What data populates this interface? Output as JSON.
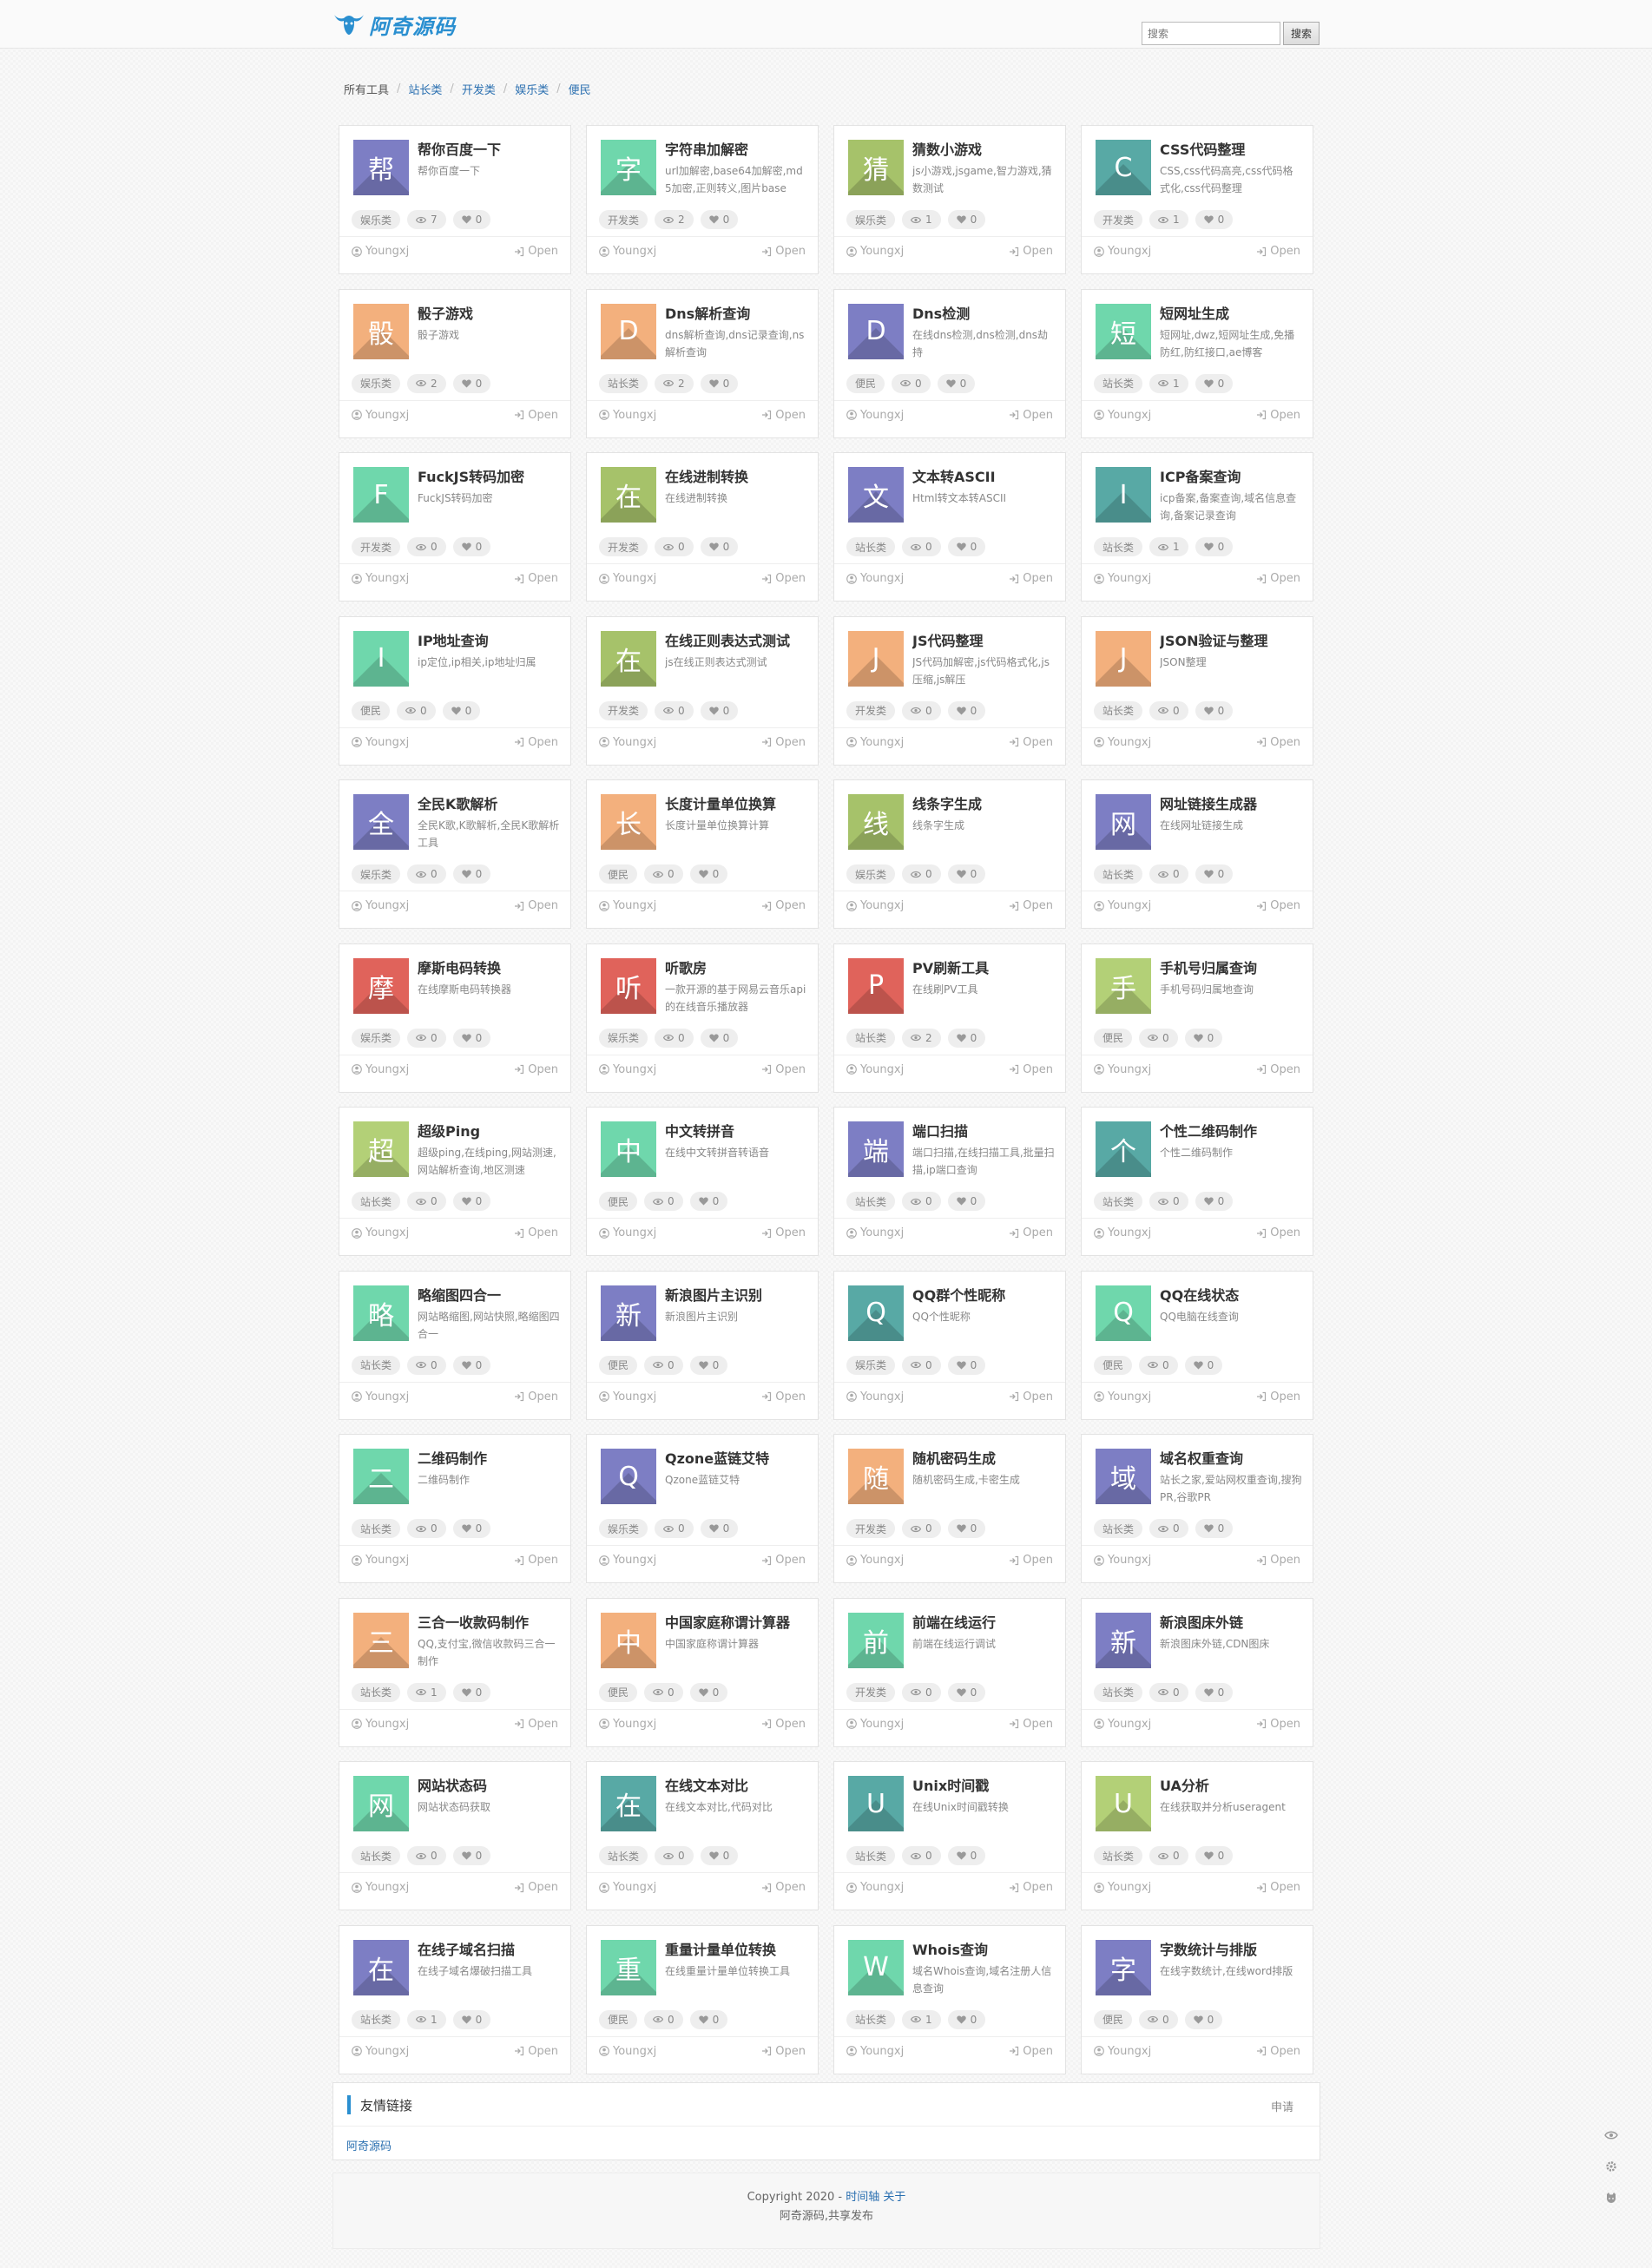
{
  "site": {
    "logo_text": "阿奇源码"
  },
  "search": {
    "placeholder": "搜索",
    "button_label": "搜索"
  },
  "breadcrumb": [
    "所有工具",
    "站长类",
    "开发类",
    "娱乐类",
    "便民"
  ],
  "card_common": {
    "author": "Youngxj",
    "open_label": "Open"
  },
  "colors": {
    "purple": "#7d7ec4",
    "mint": "#6fd7ac",
    "olive": "#a6c26a",
    "teal": "#58a9a5",
    "peach": "#f3b07d",
    "red": "#e0635b",
    "lime": "#b3d077",
    "accent_blue": "#2a8fd0"
  },
  "tools": [
    {
      "icon_char": "帮",
      "color": "purple",
      "title": "帮你百度一下",
      "desc": "帮你百度一下",
      "category": "娱乐类",
      "views": "7",
      "likes": "0"
    },
    {
      "icon_char": "字",
      "color": "mint",
      "title": "字符串加解密",
      "desc": "url加解密,base64加解密,md5加密,正则转义,图片base",
      "category": "开发类",
      "views": "2",
      "likes": "0"
    },
    {
      "icon_char": "猜",
      "color": "olive",
      "title": "猜数小游戏",
      "desc": "js小游戏,jsgame,智力游戏,猜数测试",
      "category": "娱乐类",
      "views": "1",
      "likes": "0"
    },
    {
      "icon_char": "C",
      "color": "teal",
      "title": "CSS代码整理",
      "desc": "CSS,css代码高亮,css代码格式化,css代码整理",
      "category": "开发类",
      "views": "1",
      "likes": "0"
    },
    {
      "icon_char": "骰",
      "color": "peach",
      "title": "骰子游戏",
      "desc": "骰子游戏",
      "category": "娱乐类",
      "views": "2",
      "likes": "0"
    },
    {
      "icon_char": "D",
      "color": "peach",
      "title": "Dns解析查询",
      "desc": "dns解析查询,dns记录查询,ns解析查询",
      "category": "站长类",
      "views": "2",
      "likes": "0"
    },
    {
      "icon_char": "D",
      "color": "purple",
      "title": "Dns检测",
      "desc": "在线dns检测,dns检测,dns劫持",
      "category": "便民",
      "views": "0",
      "likes": "0"
    },
    {
      "icon_char": "短",
      "color": "mint",
      "title": "短网址生成",
      "desc": "短网址,dwz,短网址生成,免播防红,防红接口,ae博客",
      "category": "站长类",
      "views": "1",
      "likes": "0"
    },
    {
      "icon_char": "F",
      "color": "mint",
      "title": "FuckJS转码加密",
      "desc": "FuckJS转码加密",
      "category": "开发类",
      "views": "0",
      "likes": "0"
    },
    {
      "icon_char": "在",
      "color": "olive",
      "title": "在线进制转换",
      "desc": "在线进制转换",
      "category": "开发类",
      "views": "0",
      "likes": "0"
    },
    {
      "icon_char": "文",
      "color": "purple",
      "title": "文本转ASCII",
      "desc": "Html转文本转ASCII",
      "category": "站长类",
      "views": "0",
      "likes": "0"
    },
    {
      "icon_char": "I",
      "color": "teal",
      "title": "ICP备案查询",
      "desc": "icp备案,备案查询,域名信息查询,备案记录查询",
      "category": "站长类",
      "views": "1",
      "likes": "0"
    },
    {
      "icon_char": "I",
      "color": "mint",
      "title": "IP地址查询",
      "desc": "ip定位,ip相关,ip地址归属",
      "category": "便民",
      "views": "0",
      "likes": "0"
    },
    {
      "icon_char": "在",
      "color": "olive",
      "title": "在线正则表达式测试",
      "desc": "js在线正则表达式测试",
      "category": "开发类",
      "views": "0",
      "likes": "0"
    },
    {
      "icon_char": "J",
      "color": "peach",
      "title": "JS代码整理",
      "desc": "JS代码加解密,js代码格式化,js压缩,js解压",
      "category": "开发类",
      "views": "0",
      "likes": "0"
    },
    {
      "icon_char": "J",
      "color": "peach",
      "title": "JSON验证与整理",
      "desc": "JSON整理",
      "category": "站长类",
      "views": "0",
      "likes": "0"
    },
    {
      "icon_char": "全",
      "color": "purple",
      "title": "全民K歌解析",
      "desc": "全民K歌,K歌解析,全民K歌解析工具",
      "category": "娱乐类",
      "views": "0",
      "likes": "0"
    },
    {
      "icon_char": "长",
      "color": "peach",
      "title": "长度计量单位换算",
      "desc": "长度计量单位换算计算",
      "category": "便民",
      "views": "0",
      "likes": "0"
    },
    {
      "icon_char": "线",
      "color": "olive",
      "title": "线条字生成",
      "desc": "线条字生成",
      "category": "娱乐类",
      "views": "0",
      "likes": "0"
    },
    {
      "icon_char": "网",
      "color": "purple",
      "title": "网址链接生成器",
      "desc": "在线网址链接生成",
      "category": "站长类",
      "views": "0",
      "likes": "0"
    },
    {
      "icon_char": "摩",
      "color": "red",
      "title": "摩斯电码转换",
      "desc": "在线摩斯电码转换器",
      "category": "娱乐类",
      "views": "0",
      "likes": "0"
    },
    {
      "icon_char": "听",
      "color": "red",
      "title": "听歌房",
      "desc": "一款开源的基于网易云音乐api的在线音乐播放器",
      "category": "娱乐类",
      "views": "0",
      "likes": "0"
    },
    {
      "icon_char": "P",
      "color": "red",
      "title": "PV刷新工具",
      "desc": "在线刷PV工具",
      "category": "站长类",
      "views": "2",
      "likes": "0"
    },
    {
      "icon_char": "手",
      "color": "lime",
      "title": "手机号归属查询",
      "desc": "手机号码归属地查询",
      "category": "便民",
      "views": "0",
      "likes": "0"
    },
    {
      "icon_char": "超",
      "color": "lime",
      "title": "超级Ping",
      "desc": "超级ping,在线ping,网站测速,网站解析查询,地区测速",
      "category": "站长类",
      "views": "0",
      "likes": "0"
    },
    {
      "icon_char": "中",
      "color": "mint",
      "title": "中文转拼音",
      "desc": "在线中文转拼音转语音",
      "category": "便民",
      "views": "0",
      "likes": "0"
    },
    {
      "icon_char": "端",
      "color": "purple",
      "title": "端口扫描",
      "desc": "端口扫描,在线扫描工具,批量扫描,ip端口查询",
      "category": "站长类",
      "views": "0",
      "likes": "0"
    },
    {
      "icon_char": "个",
      "color": "teal",
      "title": "个性二维码制作",
      "desc": "个性二维码制作",
      "category": "站长类",
      "views": "0",
      "likes": "0"
    },
    {
      "icon_char": "略",
      "color": "mint",
      "title": "略缩图四合一",
      "desc": "网站略缩图,网站快照,略缩图四合一",
      "category": "站长类",
      "views": "0",
      "likes": "0"
    },
    {
      "icon_char": "新",
      "color": "purple",
      "title": "新浪图片主识别",
      "desc": "新浪图片主识别",
      "category": "便民",
      "views": "0",
      "likes": "0"
    },
    {
      "icon_char": "Q",
      "color": "teal",
      "title": "QQ群个性昵称",
      "desc": "QQ个性昵称",
      "category": "娱乐类",
      "views": "0",
      "likes": "0"
    },
    {
      "icon_char": "Q",
      "color": "mint",
      "title": "QQ在线状态",
      "desc": "QQ电脑在线查询",
      "category": "便民",
      "views": "0",
      "likes": "0"
    },
    {
      "icon_char": "二",
      "color": "mint",
      "title": "二维码制作",
      "desc": "二维码制作",
      "category": "站长类",
      "views": "0",
      "likes": "0"
    },
    {
      "icon_char": "Q",
      "color": "purple",
      "title": "Qzone蓝链艾特",
      "desc": "Qzone蓝链艾特",
      "category": "娱乐类",
      "views": "0",
      "likes": "0"
    },
    {
      "icon_char": "随",
      "color": "peach",
      "title": "随机密码生成",
      "desc": "随机密码生成,卡密生成",
      "category": "开发类",
      "views": "0",
      "likes": "0"
    },
    {
      "icon_char": "域",
      "color": "purple",
      "title": "域名权重查询",
      "desc": "站长之家,爱站网权重查询,搜狗PR,谷歌PR",
      "category": "站长类",
      "views": "0",
      "likes": "0"
    },
    {
      "icon_char": "三",
      "color": "peach",
      "title": "三合一收款码制作",
      "desc": "QQ,支付宝,微信收款码三合一制作",
      "category": "站长类",
      "views": "1",
      "likes": "0"
    },
    {
      "icon_char": "中",
      "color": "peach",
      "title": "中国家庭称谓计算器",
      "desc": "中国家庭称谓计算器",
      "category": "便民",
      "views": "0",
      "likes": "0"
    },
    {
      "icon_char": "前",
      "color": "mint",
      "title": "前端在线运行",
      "desc": "前端在线运行调试",
      "category": "开发类",
      "views": "0",
      "likes": "0"
    },
    {
      "icon_char": "新",
      "color": "purple",
      "title": "新浪图床外链",
      "desc": "新浪图床外链,CDN图床",
      "category": "站长类",
      "views": "0",
      "likes": "0"
    },
    {
      "icon_char": "网",
      "color": "mint",
      "title": "网站状态码",
      "desc": "网站状态码获取",
      "category": "站长类",
      "views": "0",
      "likes": "0"
    },
    {
      "icon_char": "在",
      "color": "teal",
      "title": "在线文本对比",
      "desc": "在线文本对比,代码对比",
      "category": "站长类",
      "views": "0",
      "likes": "0"
    },
    {
      "icon_char": "U",
      "color": "teal",
      "title": "Unix时间戳",
      "desc": "在线Unix时间戳转换",
      "category": "站长类",
      "views": "0",
      "likes": "0"
    },
    {
      "icon_char": "U",
      "color": "lime",
      "title": "UA分析",
      "desc": "在线获取并分析useragent",
      "category": "站长类",
      "views": "0",
      "likes": "0"
    },
    {
      "icon_char": "在",
      "color": "purple",
      "title": "在线子域名扫描",
      "desc": "在线子域名爆破扫描工具",
      "category": "站长类",
      "views": "1",
      "likes": "0"
    },
    {
      "icon_char": "重",
      "color": "mint",
      "title": "重量计量单位转换",
      "desc": "在线重量计量单位转换工具",
      "category": "便民",
      "views": "0",
      "likes": "0"
    },
    {
      "icon_char": "W",
      "color": "mint",
      "title": "Whois查询",
      "desc": "域名Whois查询,域名注册人信息查询",
      "category": "站长类",
      "views": "1",
      "likes": "0"
    },
    {
      "icon_char": "字",
      "color": "purple",
      "title": "字数统计与排版",
      "desc": "在线字数统计,在线word排版",
      "category": "便民",
      "views": "0",
      "likes": "0"
    }
  ],
  "friend_links": {
    "title": "友情链接",
    "apply_label": "申请",
    "items": [
      "阿奇源码"
    ]
  },
  "footer": {
    "copyright": "Copyright 2020 - ",
    "link1": "时间轴",
    "link2": "关于",
    "tagline": "阿奇源码,共享发布"
  }
}
